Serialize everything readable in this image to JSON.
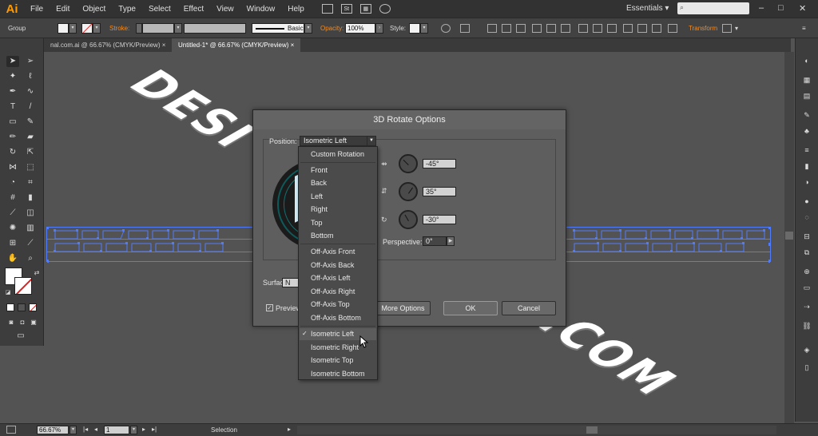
{
  "app": {
    "logo": "Ai"
  },
  "menubar": {
    "items": [
      "File",
      "Edit",
      "Object",
      "Type",
      "Select",
      "Effect",
      "View",
      "Window",
      "Help"
    ],
    "icons": [
      "bridge-icon",
      "stock-icon",
      "arrange-documents-icon",
      "gpu-icon"
    ],
    "stock_label": "St",
    "workspace": "Essentials",
    "window_buttons": [
      "–",
      "□",
      "✕"
    ]
  },
  "controlbar": {
    "selection_type": "Group",
    "stroke_label": "Stroke:",
    "brush": "Basic",
    "opacity_label": "Opacity:",
    "opacity_value": "100%",
    "style_label": "Style:",
    "transform_label": "Transform"
  },
  "tabs": [
    {
      "label": "nal.com.ai @ 66.67% (CMYK/Preview)",
      "active": false
    },
    {
      "label": "Untitled-1* @ 66.67% (CMYK/Preview)",
      "active": true
    }
  ],
  "status": {
    "zoom": "66.67%",
    "artboard_number": "1",
    "tool": "Selection"
  },
  "artwork": {
    "top_word": "DESI",
    "bottom_word": ".COM"
  },
  "dialog": {
    "title": "3D Rotate Options",
    "position_label": "Position:",
    "position_value": "Isometric Left",
    "rotation_x": "-45°",
    "rotation_y": "35°",
    "rotation_z": "-30°",
    "perspective_label": "Perspective:",
    "perspective_value": "0°",
    "surface_label": "Surface:",
    "surface_value": "N",
    "preview_label": "Preview",
    "preview_checked": true,
    "more_options": "More Options",
    "ok": "OK",
    "cancel": "Cancel"
  },
  "dropdown": {
    "items": [
      "Custom Rotation",
      "Front",
      "Back",
      "Left",
      "Right",
      "Top",
      "Bottom",
      "Off-Axis Front",
      "Off-Axis Back",
      "Off-Axis Left",
      "Off-Axis Right",
      "Off-Axis Top",
      "Off-Axis Bottom",
      "Isometric Left",
      "Isometric Right",
      "Isometric Top",
      "Isometric Bottom"
    ],
    "selected": "Isometric Left",
    "check_mark": "✓"
  },
  "colors": {
    "accent_orange": "#f08a24",
    "selection_blue": "#4f7bff",
    "cube_face": "#5fb3d3"
  }
}
